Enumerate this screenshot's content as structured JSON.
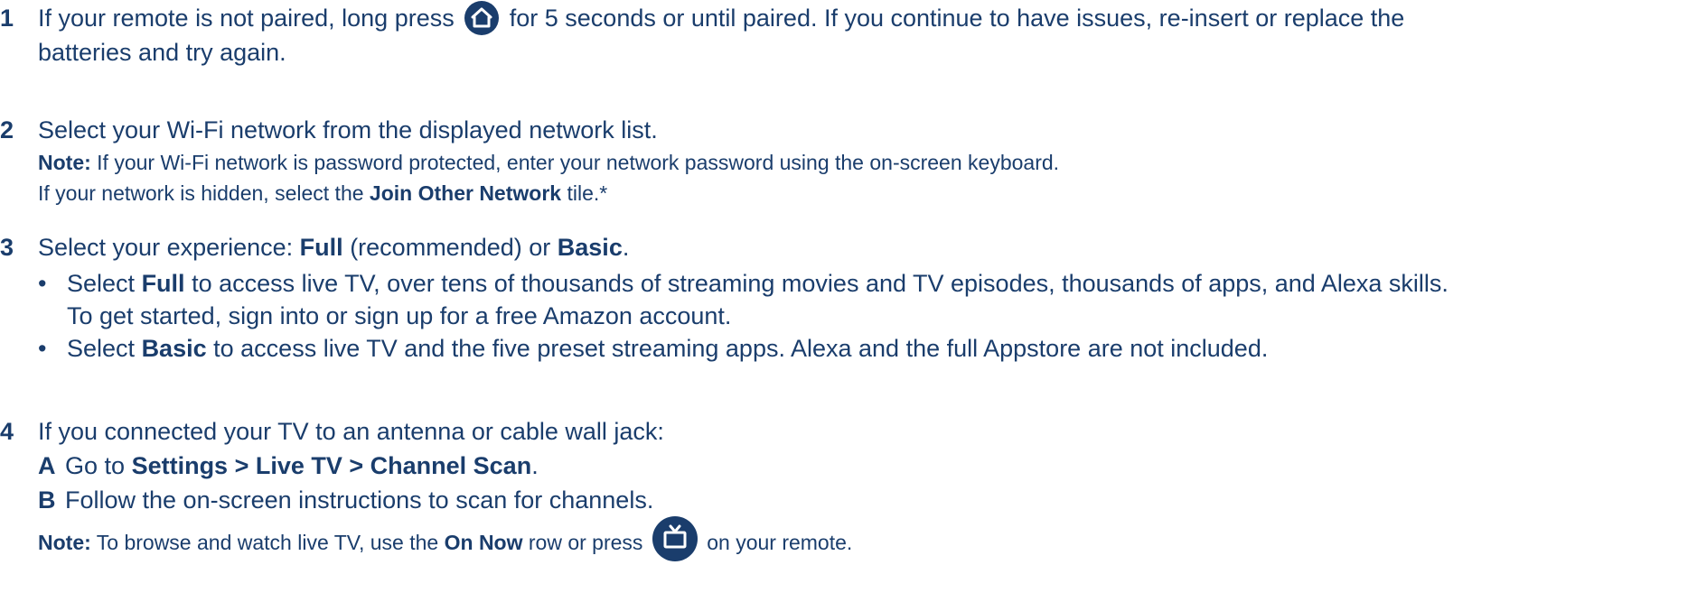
{
  "step1": {
    "number": "1",
    "text_a": "If your remote is not paired, long press",
    "icon": "home-icon",
    "text_b": "for 5 seconds or until paired. If you continue to have issues, re-insert or replace the",
    "text_c": "batteries and try again."
  },
  "step2": {
    "number": "2",
    "text": "Select your Wi-Fi network from the displayed network list.",
    "note_label": "Note:",
    "note_text": "If your Wi-Fi network is password protected, enter your network password using the on-screen keyboard.",
    "hidden_a": "If your network is hidden, select the",
    "hidden_bold": "Join Other Network",
    "hidden_b": "tile.*"
  },
  "step3": {
    "number": "3",
    "text_a": "Select your experience:",
    "full": "Full",
    "text_b": "(recommended) or",
    "basic": "Basic",
    "text_c": ".",
    "bullet1_a": "Select",
    "bullet1_bold": "Full",
    "bullet1_b": "to access live TV, over tens of thousands of streaming movies and TV episodes, thousands of apps, and Alexa skills.",
    "bullet1_c": "To get started, sign into or sign up for a free Amazon account.",
    "bullet2_a": "Select",
    "bullet2_bold": "Basic",
    "bullet2_b": "to access live TV and the five preset streaming apps. Alexa and the full Appstore are not included."
  },
  "step4": {
    "number": "4",
    "text": "If you connected your TV to an antenna or cable wall jack:",
    "a_letter": "A",
    "a_text": "Go to",
    "a_bold": "Settings > Live TV > Channel Scan",
    "a_end": ".",
    "b_letter": "B",
    "b_text": "Follow the on-screen instructions to scan for channels.",
    "note_label": "Note:",
    "note_a": "To browse and watch live TV, use the",
    "note_bold": "On Now",
    "note_b": "row or press",
    "note_icon": "live-tv-icon",
    "note_c": "on your remote."
  },
  "colors": {
    "text": "#1a3d6c"
  }
}
